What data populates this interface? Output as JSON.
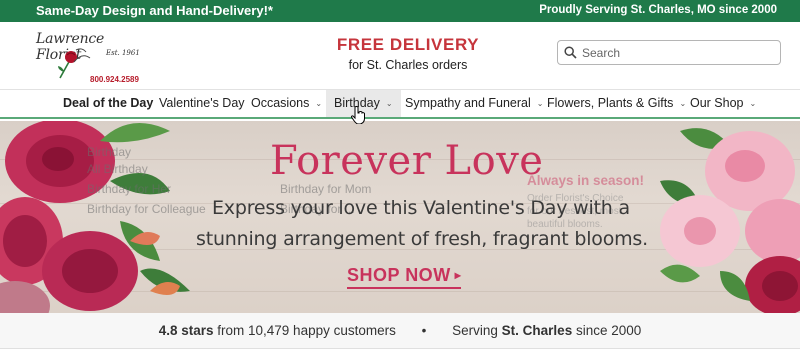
{
  "topbar": {
    "left_text": "Same-Day Design and Hand-Delivery!*",
    "right_text": "Proudly Serving St. Charles, MO since 2000",
    "color": "#1f7a4a"
  },
  "logo": {
    "name": "Lawrence Florist",
    "est": "Est. 1961",
    "phone": "800.924.2589",
    "icon": "rose-logo-icon"
  },
  "promo": {
    "title": "FREE DELIVERY",
    "subtitle": "for St. Charles orders",
    "color": "#c6353c"
  },
  "search": {
    "placeholder": "Search",
    "value": ""
  },
  "nav": {
    "items": [
      {
        "label": "Deal of the Day",
        "has_dropdown": false
      },
      {
        "label": "Valentine's Day",
        "has_dropdown": false
      },
      {
        "label": "Occasions",
        "has_dropdown": true
      },
      {
        "label": "Birthday",
        "has_dropdown": true,
        "active": true
      },
      {
        "label": "Sympathy and Funeral",
        "has_dropdown": true
      },
      {
        "label": "Flowers, Plants & Gifts",
        "has_dropdown": true
      },
      {
        "label": "Our Shop",
        "has_dropdown": true
      }
    ],
    "accent": "#5aa978"
  },
  "dropdown_fading": {
    "col1": [
      "Birthday",
      "All Birthday",
      "Birthday for Her",
      "Birthday for Colleague"
    ],
    "col2": [
      "Birthday for Mom",
      "Birthday for ..."
    ],
    "col3_title": "Always in season!",
    "col3_lines": [
      "Order Florist's Choice",
      "for our freshest, most",
      "beautiful blooms."
    ]
  },
  "hero": {
    "title": "Forever Love",
    "subtitle_line1": "Express your love this Valentine's Day with a",
    "subtitle_line2": "stunning arrangement of fresh, fragrant blooms.",
    "cta": "SHOP NOW",
    "cta_arrow": "▸",
    "accent": "#c8335c"
  },
  "trust": {
    "rating": "4.8 stars",
    "rating_rest": "from 10,479 happy customers",
    "separator": "•",
    "serving_prefix": "Serving",
    "serving_city": "St. Charles",
    "serving_suffix": "since 2000"
  }
}
